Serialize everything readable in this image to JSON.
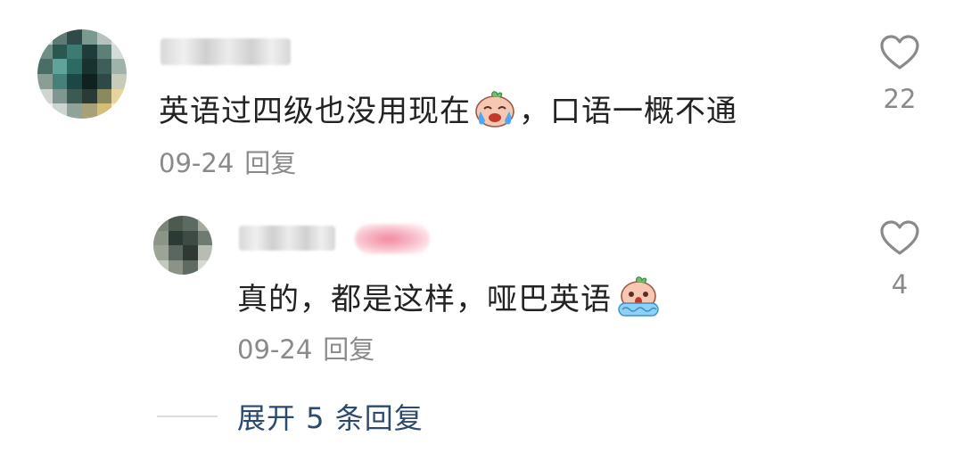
{
  "comment": {
    "username": "",
    "text_before_emoji": "英语过四级也没用现在",
    "text_after_emoji": "，口语一概不通",
    "emoji": "crying-laughing-emoji",
    "date": "09-24",
    "reply_label": "回复",
    "like_count": "22",
    "replies": [
      {
        "username": "",
        "text_before_emoji": "真的，都是这样，哑巴英语",
        "text_after_emoji": "",
        "emoji": "scared-crying-emoji",
        "date": "09-24",
        "reply_label": "回复",
        "like_count": "4"
      }
    ],
    "expand_label": "展开 5 条回复"
  },
  "colors": {
    "text": "#222222",
    "meta": "#8a8a8a",
    "link": "#2c4a6e",
    "heart_stroke": "#8a8a8a"
  }
}
